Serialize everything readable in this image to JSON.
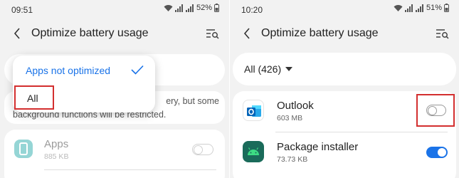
{
  "left": {
    "status": {
      "time": "09:51",
      "battery": "52%"
    },
    "appbar": {
      "title": "Optimize battery usage"
    },
    "dropdown": {
      "selected_label": "Apps not optimized",
      "all_label": "All"
    },
    "description": {
      "line1": "ery, but some",
      "line2": "background functions will be restricted."
    },
    "app_row": {
      "name": "Apps",
      "size": "885 KB",
      "toggle": false
    }
  },
  "right": {
    "status": {
      "time": "10:20",
      "battery": "51%"
    },
    "appbar": {
      "title": "Optimize battery usage"
    },
    "filter": {
      "label": "All (426)"
    },
    "apps": [
      {
        "name": "Outlook",
        "size": "603 MB",
        "icon": "outlook-icon",
        "toggle": false
      },
      {
        "name": "Package installer",
        "size": "73.73 KB",
        "icon": "android-icon",
        "toggle": true
      }
    ]
  },
  "colors": {
    "accent": "#1a73e8",
    "highlight": "#d32f2f",
    "background": "#f2f2f2",
    "card": "#ffffff",
    "teal_icon": "#16a3a3",
    "android_icon": "#1a6b5a"
  }
}
